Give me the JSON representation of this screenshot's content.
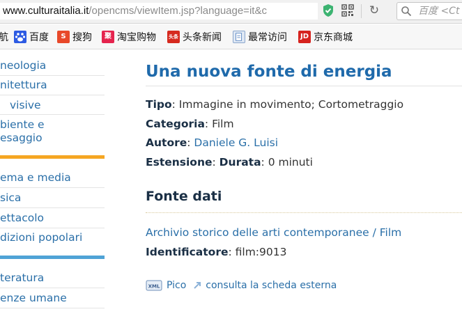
{
  "browser": {
    "url_host": "www.culturaitalia.it",
    "url_path": "/opencms/viewItem.jsp?language=it&c",
    "search_placeholder": "百度 <Ct"
  },
  "bookmarks": [
    {
      "label": "航",
      "icon": "partial-icon",
      "color": "#f1f1f1"
    },
    {
      "label": "百度",
      "icon": "baidu-paw-icon",
      "color": "#2d5be3"
    },
    {
      "label": "搜狗",
      "icon": "sogou-icon",
      "color": "#e8492a"
    },
    {
      "label": "淘宝购物",
      "icon": "taobao-icon",
      "color": "#e5244e"
    },
    {
      "label": "头条新闻",
      "icon": "toutiao-icon",
      "color": "#d62a1f"
    },
    {
      "label": "最常访问",
      "icon": "bookmark-page-icon",
      "color": "#5a86c2"
    },
    {
      "label": "京东商城",
      "icon": "jd-icon",
      "color": "#d6231e"
    }
  ],
  "nav": {
    "items": [
      "neologia",
      "nitettura",
      "visive",
      "biente e\nesaggio",
      "ema e media",
      "sica",
      "ettacolo",
      "dizioni popolari",
      "teratura",
      "enze umane"
    ],
    "accent_orange": "#f5a623",
    "accent_blue": "#4fa3d6"
  },
  "main": {
    "title": "Una nuova fonte di energia",
    "fields": {
      "tipo_label": "Tipo",
      "tipo_value": "Immagine in movimento; Cortometraggio",
      "categoria_label": "Categoria",
      "categoria_value": "Film",
      "autore_label": "Autore",
      "autore_value": "Daniele G. Luisi",
      "estensione_label": "Estensione",
      "durata_label": "Durata",
      "durata_value": "0 minuti"
    },
    "section_title": "Fonte dati",
    "source_link": "Archivio storico delle arti contemporanee / Film",
    "identificatore_label": "Identificatore",
    "identificatore_value": "film:9013",
    "pico_label": "Pico",
    "external_label": "consulta la scheda esterna",
    "colors": {
      "title": "#1f6aab",
      "link": "#2a6fa8",
      "label": "#1a2f45"
    }
  }
}
